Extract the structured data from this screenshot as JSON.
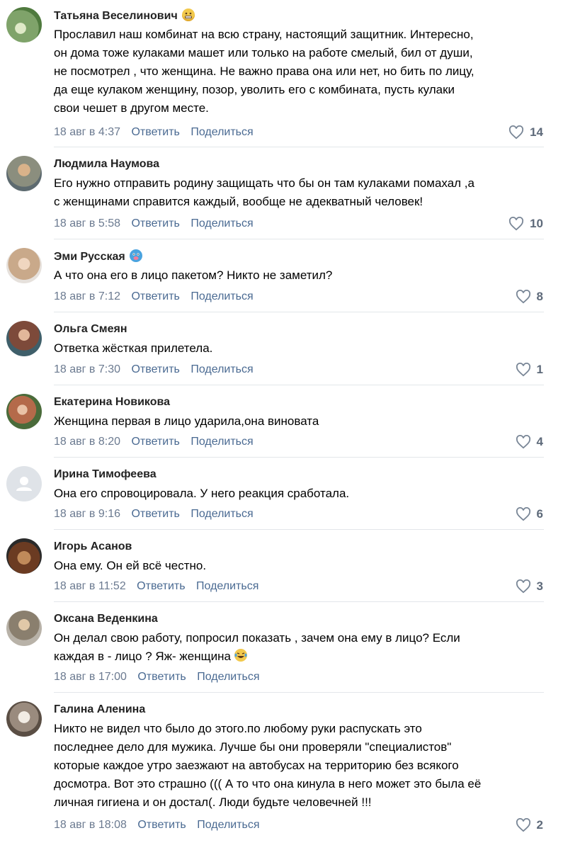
{
  "comments": [
    {
      "author": "Татьяна Веселинович",
      "text": "Прославил наш комбинат на всю страну, настоящий защитник. Интересно,\nон дома тоже кулаками машет или только на работе смелый, бил от души,\nне посмотрел , что женщина. Не важно права она или нет, но бить по лицу,\nда еще кулаком женщину, позор, уволить его с комбината, пусть кулаки\nсвои чешет в другом месте.",
      "date": "18 авг в 4:37",
      "reply": "Ответить",
      "share": "Поделиться",
      "likes": "14",
      "emoji": "grimacing-face-icon",
      "avatar_color": "#7fa36a"
    },
    {
      "author": "Людмила Наумова",
      "text": "Его нужно отправить родину защищать что бы он там кулаками помахал ,а\nс женщинами справится каждый, вообще не адекватный человек!",
      "date": "18 авг в 5:58",
      "reply": "Ответить",
      "share": "Поделиться",
      "likes": "10",
      "avatar_color": "#8b8e7e"
    },
    {
      "author": "Эми Русская",
      "text": "А что она его в лицо пакетом? Никто не заметил?",
      "date": "18 авг в 7:12",
      "reply": "Ответить",
      "share": "Поделиться",
      "likes": "8",
      "emoji": "cold-face-icon",
      "avatar_color": "#c9a98a"
    },
    {
      "author": "Ольга Смеян",
      "text": "Ответка жёсткая прилетела.",
      "date": "18 авг в 7:30",
      "reply": "Ответить",
      "share": "Поделиться",
      "likes": "1",
      "avatar_color": "#7d4a3a"
    },
    {
      "author": "Екатерина Новикова",
      "text": "Женщина первая в лицо ударила,она виновата",
      "date": "18 авг в 8:20",
      "reply": "Ответить",
      "share": "Поделиться",
      "likes": "4",
      "avatar_color": "#b46a4a"
    },
    {
      "author": "Ирина Тимофеева",
      "text": "Она его спровоцировала. У него реакция сработала.",
      "date": "18 авг в 9:16",
      "reply": "Ответить",
      "share": "Поделиться",
      "likes": "6",
      "avatar_color": "#dfe3e8"
    },
    {
      "author": "Игорь Асанов",
      "text": "Она ему. Он ей всё честно.",
      "date": "18 авг в 11:52",
      "reply": "Ответить",
      "share": "Поделиться",
      "likes": "3",
      "avatar_color": "#6b3b22"
    },
    {
      "author": "Оксана Веденкина",
      "text": "Он делал свою работу, попросил показать , зачем она ему в лицо? Если\nкаждая в - лицо ? Яж- женщина",
      "date": "18 авг в 17:00",
      "reply": "Ответить",
      "share": "Поделиться",
      "likes": "",
      "inline_emoji": "laughing-tears-icon",
      "avatar_color": "#8a7f6e"
    },
    {
      "author": "Галина Аленина",
      "text": "Никто не видел что было до этого.по любому руки распускать это\nпоследнее дело для мужика. Лучше бы они проверяли \"специалистов\"\nкоторые каждое утро заезжают на автобусах на территорию без всякого\nдосмотра. Вот это страшно ((( А то что она кинула в него может это была её\nличная гигиена и он достал(. Люди будьте человечней !!!",
      "date": "18 авг в 18:08",
      "reply": "Ответить",
      "share": "Поделиться",
      "likes": "2",
      "avatar_color": "#9a8b7e"
    }
  ]
}
